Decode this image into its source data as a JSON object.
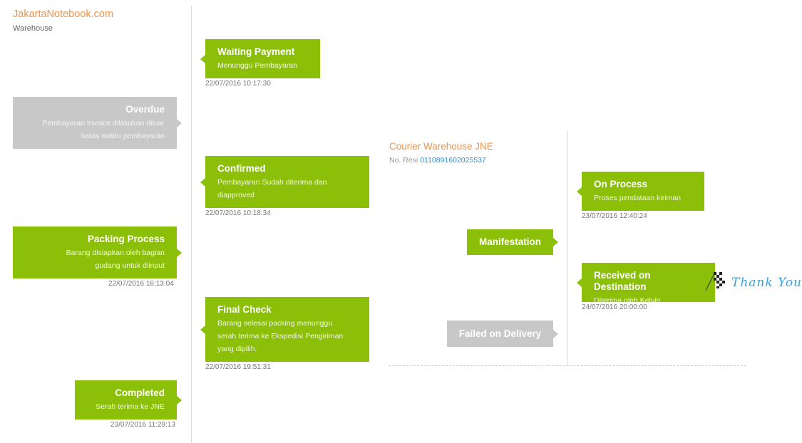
{
  "header": {
    "title": "JakartaNotebook.com",
    "subtitle": "Warehouse"
  },
  "colors": {
    "accent_green": "#8cbf08",
    "inactive_grey": "#c8c8c8",
    "brand_orange": "#f0934a",
    "link_blue": "#2e8fd8"
  },
  "warehouse": {
    "steps": [
      {
        "title": "Waiting Payment",
        "desc": "Menunggu Pembayaran",
        "timestamp": "22/07/2016 10:17:30",
        "state": "active"
      },
      {
        "title": "Overdue",
        "desc": "Pembayaran Invoice dilakukan diluar batas waktu pembayaran",
        "timestamp": "",
        "state": "inactive"
      },
      {
        "title": "Confirmed",
        "desc": "Pembayaran Sudah diterima dan diapproved",
        "timestamp": "22/07/2016 10:18:34",
        "state": "active"
      },
      {
        "title": "Packing Process",
        "desc": "Barang disiapkan oleh bagian gudang untuk diinput",
        "timestamp": "22/07/2016 16:13:04",
        "state": "active"
      },
      {
        "title": "Final Check",
        "desc": "Barang selesai packing menunggu serah terima ke Ekspedisi Pengiriman yang dipilih.",
        "timestamp": "22/07/2016 19:51:31",
        "state": "active"
      },
      {
        "title": "Completed",
        "desc": "Serah terima ke JNE",
        "timestamp": "23/07/2016 11:29:13",
        "state": "active"
      }
    ]
  },
  "courier": {
    "title": "Courier Warehouse JNE",
    "resi_label": "No. Resi",
    "resi_number": "0110891602025537",
    "steps": [
      {
        "title": "On Process",
        "desc": "Proses pendataan kiriman",
        "timestamp": "23/07/2016 12:40:24",
        "state": "active"
      },
      {
        "title": "Manifestation",
        "desc": "",
        "timestamp": "",
        "state": "active"
      },
      {
        "title": "Received on Destination",
        "desc": "Diterima oleh Kelvin",
        "timestamp": "24/07/2016 20:00:00",
        "state": "active"
      },
      {
        "title": "Failed on Delivery",
        "desc": "",
        "timestamp": "",
        "state": "inactive"
      }
    ]
  },
  "finish": {
    "icon": "checkered-flag-icon",
    "label": "Thank You"
  }
}
